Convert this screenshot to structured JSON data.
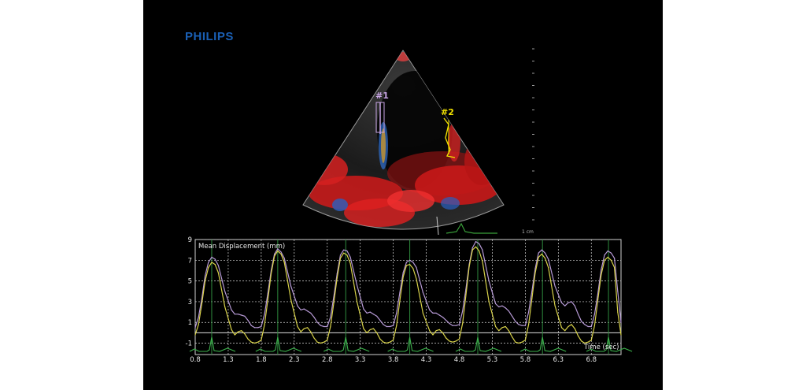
{
  "brand": {
    "logo_text": "PHILIPS",
    "color": "#1a5fb4"
  },
  "echo": {
    "markers": [
      {
        "label": "#1",
        "color": "#c9a6e6"
      },
      {
        "label": "#2",
        "color": "#f0e000"
      }
    ],
    "scale_label": "1 cm"
  },
  "chart_data": {
    "type": "line",
    "title": "",
    "ylabel": "Mean Displacement (mm)",
    "xlabel": "Time (sec)",
    "xlim": [
      0.8,
      7.25
    ],
    "ylim": [
      -2.1,
      9
    ],
    "x_ticks": [
      0.8,
      1.3,
      1.8,
      2.3,
      2.8,
      3.3,
      3.8,
      4.3,
      4.8,
      5.3,
      5.8,
      6.3,
      6.8
    ],
    "x_tick_labels": [
      "0.8",
      "1.3",
      "1.8",
      "2.3",
      "2.8",
      "3.3",
      "3.8",
      "4.3",
      "4.8",
      "5.3",
      "5.8",
      "6.3",
      "6.8"
    ],
    "y_ticks": [
      9,
      7,
      5,
      3,
      1,
      -1
    ],
    "y_tick_labels": [
      "9",
      "7",
      "5",
      "3",
      "1",
      "-1"
    ],
    "grid": true,
    "zero_line": 0,
    "beat_times": [
      1.05,
      2.05,
      3.08,
      4.05,
      5.08,
      6.06,
      7.06
    ],
    "series": [
      {
        "color": "#b79ad6",
        "x": [
          0.8,
          0.85,
          0.9,
          0.95,
          1.0,
          1.05,
          1.1,
          1.15,
          1.25,
          1.35,
          1.4,
          1.45,
          1.5,
          1.55,
          1.6,
          1.65,
          1.7,
          1.75,
          1.8,
          1.85,
          1.9,
          1.95,
          2.0,
          2.05,
          2.1,
          2.15,
          2.25,
          2.35,
          2.4,
          2.45,
          2.5,
          2.55,
          2.6,
          2.65,
          2.7,
          2.75,
          2.8,
          2.85,
          2.9,
          2.95,
          3.0,
          3.05,
          3.1,
          3.15,
          3.25,
          3.35,
          3.4,
          3.45,
          3.5,
          3.55,
          3.6,
          3.65,
          3.7,
          3.75,
          3.8,
          3.85,
          3.9,
          3.95,
          4.0,
          4.05,
          4.1,
          4.15,
          4.25,
          4.35,
          4.4,
          4.45,
          4.5,
          4.55,
          4.6,
          4.65,
          4.7,
          4.75,
          4.8,
          4.85,
          4.9,
          4.95,
          5.0,
          5.05,
          5.1,
          5.15,
          5.25,
          5.35,
          5.4,
          5.45,
          5.5,
          5.55,
          5.6,
          5.65,
          5.7,
          5.75,
          5.8,
          5.85,
          5.9,
          5.95,
          6.0,
          6.05,
          6.1,
          6.15,
          6.25,
          6.35,
          6.4,
          6.45,
          6.5,
          6.55,
          6.6,
          6.65,
          6.7,
          6.75,
          6.8,
          6.85,
          6.9,
          6.95,
          7.0,
          7.05,
          7.1,
          7.15,
          7.2,
          7.25
        ],
        "y": [
          0.5,
          1.5,
          3.3,
          5.5,
          6.8,
          7.3,
          7.1,
          6.5,
          4.0,
          2.2,
          1.8,
          1.8,
          1.7,
          1.6,
          1.2,
          0.7,
          0.5,
          0.5,
          0.6,
          1.8,
          3.8,
          6.0,
          7.6,
          8.1,
          7.8,
          7.2,
          4.5,
          2.6,
          2.2,
          2.3,
          2.1,
          1.9,
          1.5,
          1.0,
          0.7,
          0.6,
          0.6,
          1.5,
          3.5,
          5.7,
          7.5,
          8.0,
          7.9,
          7.3,
          4.6,
          2.3,
          1.9,
          2.0,
          1.8,
          1.6,
          1.2,
          0.8,
          0.6,
          0.6,
          0.7,
          1.9,
          3.9,
          5.8,
          6.8,
          7.0,
          6.8,
          6.3,
          3.9,
          2.2,
          1.9,
          1.9,
          1.7,
          1.5,
          1.2,
          0.9,
          0.7,
          0.7,
          0.8,
          2.1,
          4.2,
          6.6,
          8.2,
          8.8,
          8.6,
          8.0,
          5.0,
          2.8,
          2.5,
          2.6,
          2.4,
          2.1,
          1.6,
          1.1,
          0.8,
          0.7,
          0.7,
          2.0,
          4.0,
          6.2,
          7.7,
          8.0,
          7.7,
          7.1,
          4.5,
          2.9,
          2.6,
          2.9,
          3.0,
          2.6,
          1.8,
          1.1,
          0.8,
          0.6,
          0.6,
          1.8,
          3.8,
          6.1,
          7.5,
          7.9,
          7.7,
          7.2,
          4.0,
          1.0
        ]
      },
      {
        "color": "#d8d24a",
        "x": [
          0.8,
          0.85,
          0.9,
          0.95,
          1.0,
          1.05,
          1.1,
          1.15,
          1.25,
          1.35,
          1.4,
          1.45,
          1.5,
          1.55,
          1.6,
          1.65,
          1.7,
          1.75,
          1.8,
          1.85,
          1.9,
          1.95,
          2.0,
          2.05,
          2.1,
          2.15,
          2.25,
          2.35,
          2.4,
          2.45,
          2.5,
          2.55,
          2.6,
          2.65,
          2.7,
          2.75,
          2.8,
          2.85,
          2.9,
          2.95,
          3.0,
          3.05,
          3.1,
          3.15,
          3.25,
          3.35,
          3.4,
          3.45,
          3.5,
          3.55,
          3.6,
          3.65,
          3.7,
          3.75,
          3.8,
          3.85,
          3.9,
          3.95,
          4.0,
          4.05,
          4.1,
          4.15,
          4.25,
          4.35,
          4.4,
          4.45,
          4.5,
          4.55,
          4.6,
          4.65,
          4.7,
          4.75,
          4.8,
          4.85,
          4.9,
          4.95,
          5.0,
          5.05,
          5.1,
          5.15,
          5.25,
          5.35,
          5.4,
          5.45,
          5.5,
          5.55,
          5.6,
          5.65,
          5.7,
          5.75,
          5.8,
          5.85,
          5.9,
          5.95,
          6.0,
          6.05,
          6.1,
          6.15,
          6.25,
          6.35,
          6.4,
          6.45,
          6.5,
          6.55,
          6.6,
          6.65,
          6.7,
          6.75,
          6.8,
          6.85,
          6.9,
          6.95,
          7.0,
          7.05,
          7.1,
          7.15,
          7.2,
          7.25
        ],
        "y": [
          -0.2,
          0.8,
          2.8,
          5.0,
          6.3,
          6.8,
          6.6,
          5.8,
          2.5,
          0.3,
          -0.2,
          0.1,
          0.2,
          -0.1,
          -0.6,
          -0.9,
          -1.0,
          -0.9,
          -0.7,
          0.8,
          3.2,
          5.7,
          7.4,
          7.9,
          7.6,
          6.8,
          3.2,
          0.6,
          0.1,
          0.4,
          0.5,
          0.1,
          -0.5,
          -0.9,
          -1.0,
          -0.9,
          -0.7,
          0.6,
          2.9,
          5.3,
          7.2,
          7.7,
          7.5,
          6.7,
          3.0,
          0.4,
          0.0,
          0.3,
          0.4,
          0.0,
          -0.6,
          -0.9,
          -1.0,
          -0.9,
          -0.7,
          0.7,
          3.1,
          5.4,
          6.5,
          6.6,
          6.2,
          5.2,
          1.9,
          0.2,
          -0.2,
          0.2,
          0.3,
          0.0,
          -0.5,
          -0.8,
          -0.9,
          -0.8,
          -0.6,
          0.9,
          3.6,
          6.4,
          8.0,
          8.3,
          7.9,
          6.9,
          3.0,
          0.6,
          0.2,
          0.5,
          0.6,
          0.2,
          -0.4,
          -0.9,
          -1.0,
          -0.9,
          -0.7,
          0.8,
          3.3,
          5.8,
          7.3,
          7.6,
          7.2,
          6.3,
          2.6,
          0.5,
          0.2,
          0.6,
          0.8,
          0.4,
          -0.3,
          -0.8,
          -1.0,
          -0.9,
          -0.7,
          0.7,
          3.2,
          5.6,
          7.0,
          7.3,
          7.0,
          6.3,
          2.0,
          -0.2
        ]
      }
    ]
  }
}
